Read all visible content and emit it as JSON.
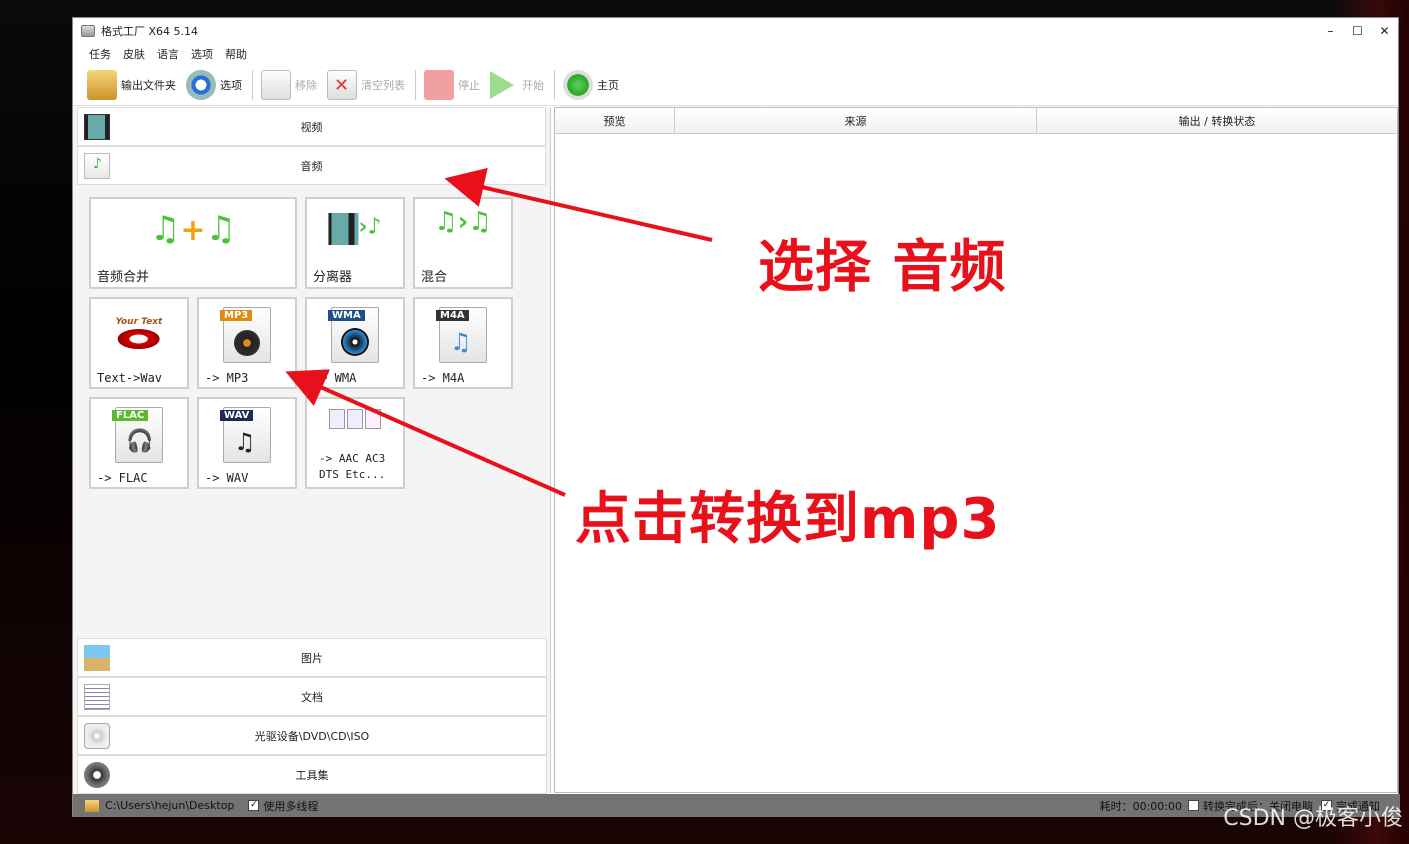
{
  "window": {
    "title": "格式工厂 X64 5.14",
    "controls": [
      "–",
      "☐",
      "✕"
    ]
  },
  "menu": [
    "任务",
    "皮肤",
    "语言",
    "选项",
    "帮助"
  ],
  "toolbar": {
    "output_folder": "输出文件夹",
    "options": "选项",
    "remove": "移除",
    "clear_list": "清空列表",
    "stop": "停止",
    "start": "开始",
    "home": "主页"
  },
  "categories": {
    "video": "视频",
    "audio": "音频",
    "picture": "图片",
    "document": "文档",
    "disc": "光驱设备\\DVD\\CD\\ISO",
    "tools": "工具集"
  },
  "audio_tiles": {
    "merge": "音频合并",
    "splitter": "分离器",
    "mix": "混合",
    "text_wav": "Text->Wav",
    "mp3": "-> MP3",
    "wma": "-> WMA",
    "m4a": "-> M4A",
    "flac": "-> FLAC",
    "wav": "-> WAV",
    "aac_line1": "-> AAC AC3",
    "aac_line2": "DTS Etc...",
    "tags": {
      "mp3": "MP3",
      "wma": "WMA",
      "m4a": "M4A",
      "flac": "FLAC",
      "wav": "WAV",
      "your_text": "Your Text"
    }
  },
  "table_headers": [
    "预览",
    "来源",
    "输出 / 转换状态"
  ],
  "statusbar": {
    "path": "C:\\Users\\hejun\\Desktop",
    "multithread": "使用多线程",
    "elapsed": "耗时：00:00:00",
    "after_convert": "转换完成后：关闭电脑",
    "notify": "完成通知"
  },
  "annotations": {
    "select_audio": "选择 音频",
    "click_mp3": "点击转换到mp3"
  },
  "watermark": "CSDN @极客小俊",
  "colors": {
    "annotation_red": "#e8101a",
    "statusbar": "#737373"
  }
}
